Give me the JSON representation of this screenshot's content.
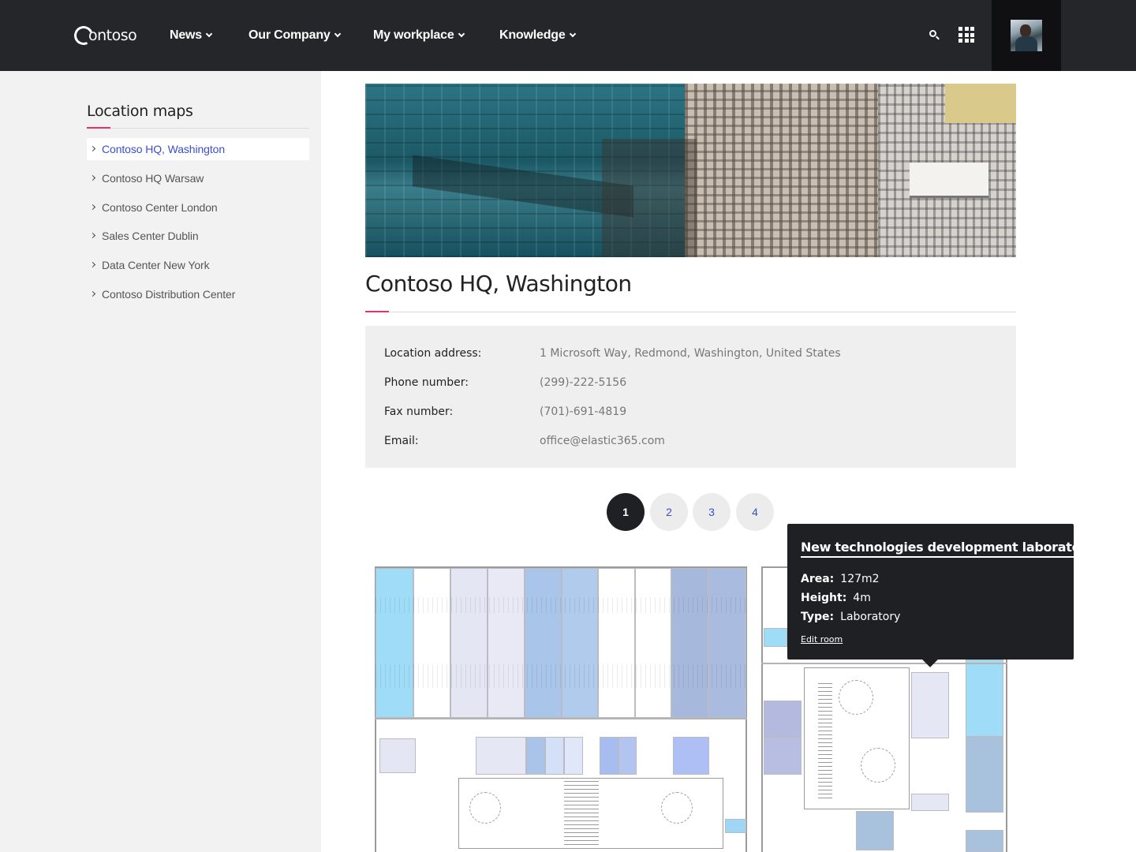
{
  "header": {
    "logo_text": "ontoso",
    "nav": [
      {
        "label": "News"
      },
      {
        "label": "Our Company"
      },
      {
        "label": "My workplace"
      },
      {
        "label": "Knowledge"
      }
    ],
    "icons": [
      "search-icon",
      "apps-grid-icon",
      "avatar"
    ]
  },
  "sidebar": {
    "title": "Location maps",
    "items": [
      {
        "label": "Contoso HQ, Washington",
        "active": true
      },
      {
        "label": "Contoso HQ Warsaw"
      },
      {
        "label": "Contoso Center London"
      },
      {
        "label": "Sales Center Dublin"
      },
      {
        "label": "Data Center New York"
      },
      {
        "label": "Contoso Distribution Center"
      }
    ]
  },
  "main": {
    "title": "Contoso HQ, Washington",
    "info": [
      {
        "label": "Location address:",
        "value": "1 Microsoft Way, Redmond, Washington, United States"
      },
      {
        "label": "Phone number:",
        "value": "(299)-222-5156"
      },
      {
        "label": "Fax number:",
        "value": "(701)-691-4819"
      },
      {
        "label": "Email:",
        "value": "office@elastic365.com"
      }
    ],
    "pages": [
      "1",
      "2",
      "3",
      "4"
    ],
    "active_page": "1"
  },
  "tooltip": {
    "title": "New technologies development laboratory",
    "area_label": "Area:",
    "area_value": "127m2",
    "height_label": "Height:",
    "height_value": "4m",
    "type_label": "Type:",
    "type_value": "Laboratory",
    "link": "Edit room"
  },
  "colors": {
    "accent": "#e8306a",
    "link": "#3a4fd0",
    "header_bg": "#25262a",
    "sidebar_bg": "#f2f2f2"
  }
}
